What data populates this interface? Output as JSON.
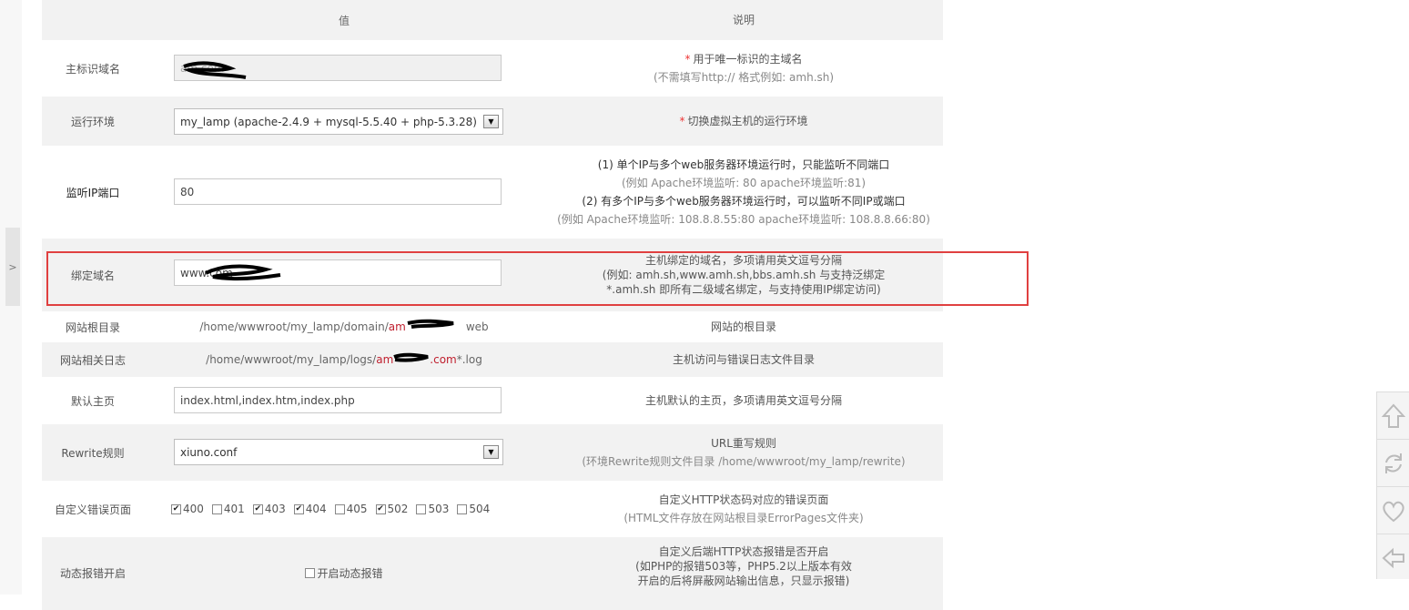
{
  "header": {
    "value_col": "值",
    "desc_col": "说明"
  },
  "side_toggle": {
    "glyph": ">"
  },
  "rows": {
    "domain": {
      "label": "主标识域名",
      "input_value": "am.com",
      "desc_required": "*",
      "desc_main": "用于唯一标识的主域名",
      "desc_hint": "(不需填写http:// 格式例如: amh.sh)"
    },
    "env": {
      "label": "运行环境",
      "select_value": "my_lamp (apache-2.4.9 + mysql-5.5.40 + php-5.3.28)",
      "desc_required": "*",
      "desc_main": "切换虚拟主机的运行环境"
    },
    "port": {
      "label": "监听IP端口",
      "input_value": "80",
      "desc_line1": "(1) 单个IP与多个web服务器环境运行时，只能监听不同端口",
      "desc_line2": "(例如 Apache环境监听: 80   apache环境监听:81)",
      "desc_line3": "(2) 有多个IP与多个web服务器环境运行时，可以监听不同IP或端口",
      "desc_line4": "(例如 Apache环境监听: 108.8.8.55:80   apache环境监听: 108.8.8.66:80)"
    },
    "bind": {
      "label": "绑定域名",
      "input_value": "www.com",
      "desc_line1": "主机绑定的域名，多项请用英文逗号分隔",
      "desc_line2": "(例如: amh.sh,www.amh.sh,bbs.amh.sh 与支持泛绑定",
      "desc_line3": "*.amh.sh 即所有二级域名绑定，与支持使用IP绑定访问)"
    },
    "root": {
      "label": "网站根目录",
      "path_prefix": "/home/wwwroot/my_lamp/domain/",
      "path_red": "am",
      "path_suffix": "web",
      "desc": "网站的根目录"
    },
    "log": {
      "label": "网站相关日志",
      "path_prefix": "/home/wwwroot/my_lamp/logs/",
      "path_red": "am",
      "path_red2": ".com",
      "path_suffix": "*.log",
      "desc": "主机访问与错误日志文件目录"
    },
    "index": {
      "label": "默认主页",
      "input_value": "index.html,index.htm,index.php",
      "desc": "主机默认的主页，多项请用英文逗号分隔"
    },
    "rewrite": {
      "label": "Rewrite规则",
      "select_value": "xiuno.conf",
      "desc_line1": "URL重写规则",
      "desc_line2": "(环境Rewrite规则文件目录 /home/wwwroot/my_lamp/rewrite)"
    },
    "errors": {
      "label": "自定义错误页面",
      "codes": [
        {
          "code": "400",
          "checked": true
        },
        {
          "code": "401",
          "checked": false
        },
        {
          "code": "403",
          "checked": true
        },
        {
          "code": "404",
          "checked": true
        },
        {
          "code": "405",
          "checked": false
        },
        {
          "code": "502",
          "checked": true
        },
        {
          "code": "503",
          "checked": false
        },
        {
          "code": "504",
          "checked": false
        }
      ],
      "desc_line1": "自定义HTTP状态码对应的错误页面",
      "desc_line2": "(HTML文件存放在网站根目录ErrorPages文件夹)"
    },
    "dynamic": {
      "label": "动态报错开启",
      "checkbox_label": "开启动态报错",
      "checked": false,
      "desc_line1": "自定义后端HTTP状态报错是否开启",
      "desc_line2": "(如PHP的报错503等，PHP5.2以上版本有效",
      "desc_line3": "开启的后将屏蔽网站输出信息，只显示报错)"
    }
  },
  "tools": [
    "arrow-up-icon",
    "refresh-icon",
    "heart-icon",
    "share-back-icon"
  ],
  "colors": {
    "highlight": "#e04040",
    "required": "#e33333",
    "path_red": "#c0202f"
  }
}
